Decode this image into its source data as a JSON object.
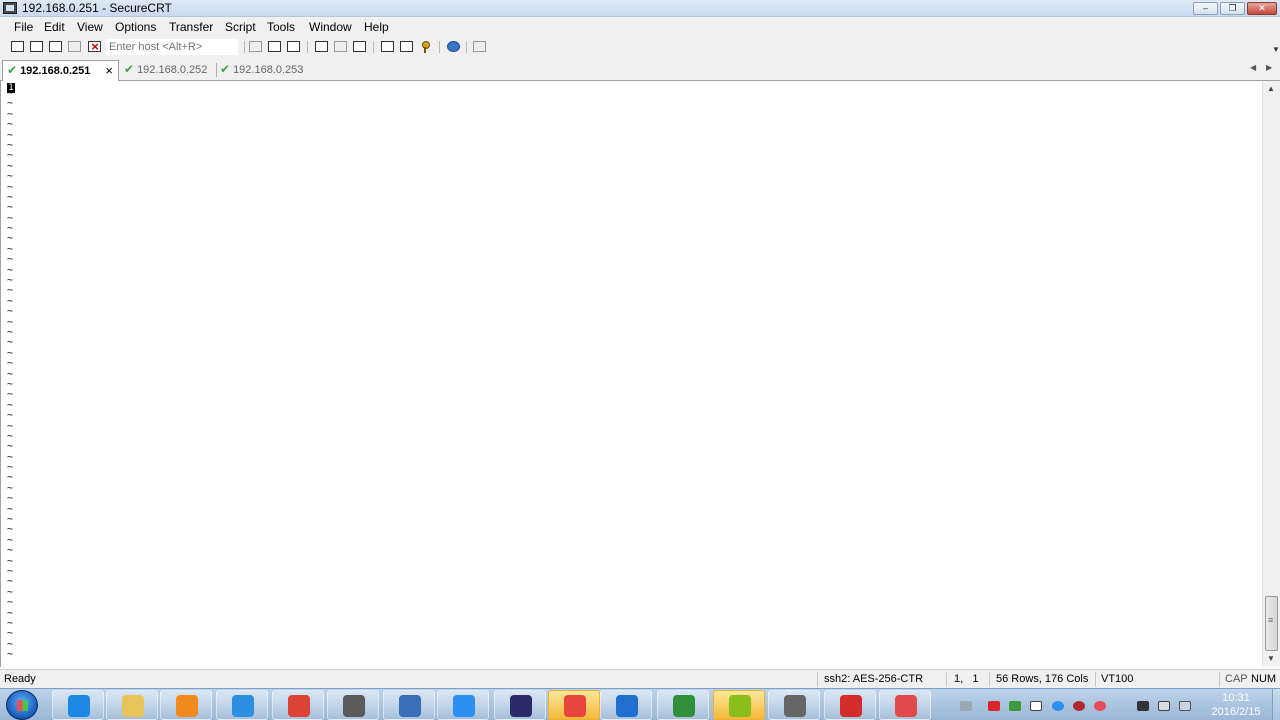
{
  "window": {
    "title": "192.168.0.251 - SecureCRT",
    "controls": {
      "minimize": "–",
      "maximize": "❐",
      "close": "✕"
    }
  },
  "menu": [
    "File",
    "Edit",
    "View",
    "Options",
    "Transfer",
    "Script",
    "Tools",
    "Window",
    "Help"
  ],
  "toolbar": {
    "host_placeholder": "Enter host <Alt+R>",
    "buttons_left": [
      "connect-icon",
      "quick-connect-icon",
      "connect-in-tab-icon",
      "reconnect-icon",
      "disconnect-icon"
    ],
    "buttons_right": [
      "copy-icon",
      "paste-icon",
      "find-icon",
      "print-icon",
      "print-selection-icon",
      "print-setup-icon",
      "session-options-icon",
      "global-options-icon",
      "keymap-icon",
      "help-icon",
      "sftp-icon"
    ]
  },
  "tabs": [
    {
      "label": "192.168.0.251",
      "active": true,
      "status": "connected"
    },
    {
      "label": "192.168.0.252",
      "active": false,
      "status": "connected"
    },
    {
      "label": "192.168.0.253",
      "active": false,
      "status": "connected"
    }
  ],
  "tab_close": "×",
  "terminal": {
    "cursor_text": "1",
    "empty_line_marker": "~",
    "empty_line_count": 55
  },
  "status": {
    "ready": "Ready",
    "cipher": "ssh2: AES-256-CTR",
    "position": "1,   1",
    "dimensions": "56 Rows, 176 Cols",
    "emulation": "VT100",
    "caps": "CAP",
    "num": "NUM"
  },
  "taskbar": {
    "clock_time": "10:31",
    "clock_date": "2016/2/15",
    "apps": [
      {
        "name": "internet-explorer-icon",
        "color": "#1e88e5"
      },
      {
        "name": "file-explorer-icon",
        "color": "#e8c35a"
      },
      {
        "name": "media-player-icon",
        "color": "#f08a1e"
      },
      {
        "name": "cloud-sync-icon",
        "color": "#2c8fe0"
      },
      {
        "name": "chrome-icon",
        "color": "#db4437"
      },
      {
        "name": "terminal-app-icon",
        "color": "#5a5a5a"
      },
      {
        "name": "network-lock-icon",
        "color": "#3a6fb8"
      },
      {
        "name": "feather-app-icon",
        "color": "#2d8ff0"
      },
      {
        "name": "eclipse-icon",
        "color": "#2c2a6b"
      },
      {
        "name": "presentation-icon",
        "color": "#e8463c"
      },
      {
        "name": "virtualbox-icon",
        "color": "#1e6fcf"
      },
      {
        "name": "project-app-icon",
        "color": "#2f8f3a"
      },
      {
        "name": "m-app-icon",
        "color": "#8bbd1c"
      },
      {
        "name": "securecrt-icon",
        "color": "#666666"
      },
      {
        "name": "pdf-reader-icon",
        "color": "#d42b2b"
      },
      {
        "name": "eraser-app-icon",
        "color": "#e04a4a"
      }
    ]
  }
}
